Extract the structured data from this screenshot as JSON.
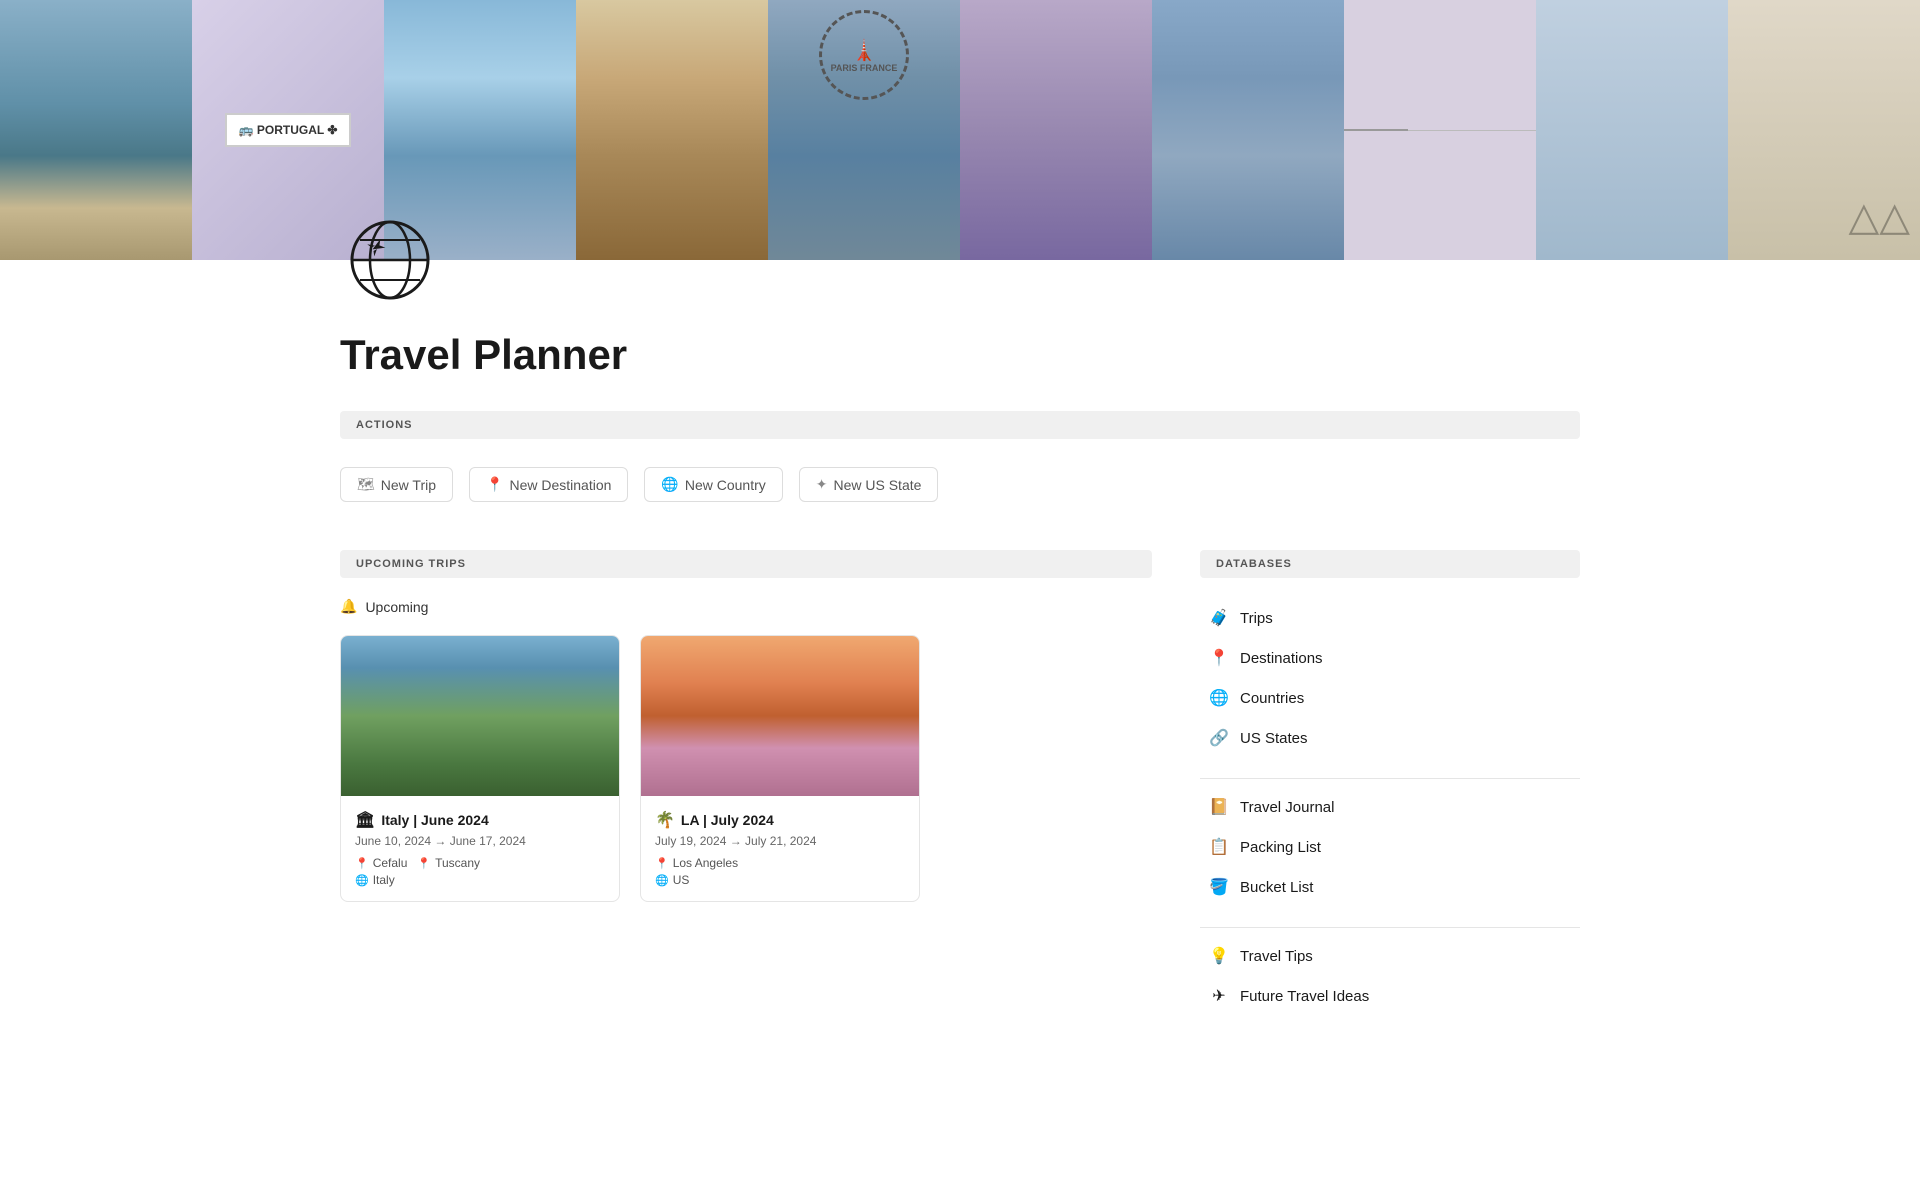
{
  "page": {
    "title": "Travel Planner"
  },
  "banner": {
    "alt": "Travel photo collage banner"
  },
  "actions": {
    "section_label": "ACTIONS",
    "buttons": [
      {
        "id": "new-trip",
        "label": "New Trip",
        "icon": "🗺"
      },
      {
        "id": "new-destination",
        "label": "New Destination",
        "icon": "📍"
      },
      {
        "id": "new-country",
        "label": "New Country",
        "icon": "🌐"
      },
      {
        "id": "new-us-state",
        "label": "New US State",
        "icon": "✦"
      }
    ]
  },
  "upcoming_trips": {
    "section_label": "UPCOMING TRIPS",
    "filter_label": "Upcoming",
    "trips": [
      {
        "id": "italy",
        "emoji": "🏛",
        "title": "Italy | June 2024",
        "dates": "June 10, 2024 → June 17, 2024",
        "destinations": [
          "Cefalu",
          "Tuscany"
        ],
        "country": "Italy",
        "image_type": "italy"
      },
      {
        "id": "la",
        "emoji": "🌴",
        "title": "LA | July 2024",
        "dates": "July 19, 2024 → July 21, 2024",
        "destinations": [
          "Los Angeles"
        ],
        "country": "US",
        "image_type": "la"
      }
    ]
  },
  "databases": {
    "section_label": "DATABASES",
    "groups": [
      {
        "items": [
          {
            "id": "trips",
            "icon": "🧳",
            "label": "Trips"
          },
          {
            "id": "destinations",
            "icon": "📍",
            "label": "Destinations"
          },
          {
            "id": "countries",
            "icon": "🌐",
            "label": "Countries"
          },
          {
            "id": "us-states",
            "icon": "🔗",
            "label": "US States"
          }
        ]
      },
      {
        "items": [
          {
            "id": "travel-journal",
            "icon": "📔",
            "label": "Travel Journal"
          },
          {
            "id": "packing-list",
            "icon": "📋",
            "label": "Packing List"
          },
          {
            "id": "bucket-list",
            "icon": "🪣",
            "label": "Bucket List"
          }
        ]
      },
      {
        "items": [
          {
            "id": "travel-tips",
            "icon": "💡",
            "label": "Travel Tips"
          },
          {
            "id": "future-travel-ideas",
            "icon": "✈",
            "label": "Future Travel Ideas"
          }
        ]
      }
    ]
  }
}
